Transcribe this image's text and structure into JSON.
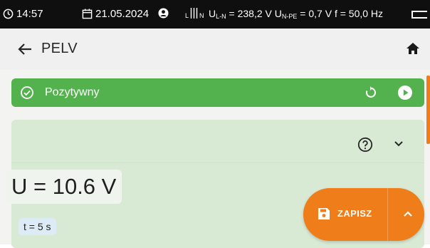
{
  "status_bar": {
    "time": "14:57",
    "date": "21.05.2024",
    "l_label": "L",
    "n_label": "N",
    "measure_u_ln_value": "= 238,2 V",
    "u_ln_sub": "L-N",
    "u_npe_sub": "N-PE",
    "measure_u_npe_value": "= 0,7 V",
    "measure_f": "f = 50,0 Hz",
    "u_letter": "U"
  },
  "header": {
    "title": "PELV"
  },
  "result": {
    "label": "Pozytywny"
  },
  "measurement": {
    "main_value": "U = 10.6 V",
    "time": "t = 5 s"
  },
  "save_button": {
    "label": "ZAPISZ"
  },
  "colors": {
    "status_bar": "#0f0f0f",
    "header": "#f0f0f0",
    "result_green": "#54b24e",
    "card_green": "#d8ead4",
    "accent_orange": "#ef7d1a",
    "chip_blue": "#dcebf6"
  },
  "icons": {
    "clock": "clock-icon",
    "calendar": "calendar-icon",
    "person": "person-icon",
    "back": "arrow-left-icon",
    "home": "home-icon",
    "check": "check-circle-icon",
    "undo": "undo-icon",
    "play": "play-icon",
    "help": "help-icon",
    "expand": "chevron-down-icon",
    "save": "save-icon",
    "fab_expand": "chevron-up-icon",
    "battery": "battery-icon"
  }
}
